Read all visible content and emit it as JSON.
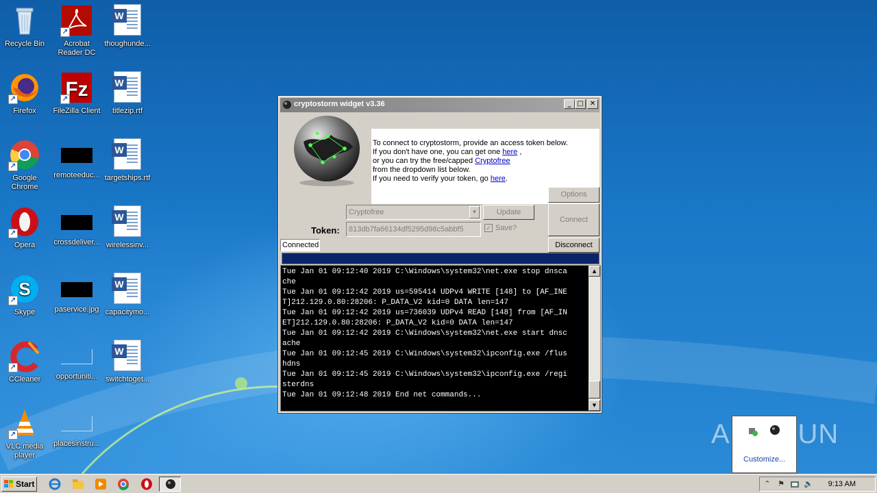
{
  "desktop": {
    "icons": [
      {
        "label": "Recycle Bin"
      },
      {
        "label": "Acrobat Reader DC"
      },
      {
        "label": "thoughunde..."
      },
      {
        "label": "Firefox"
      },
      {
        "label": "FileZilla Client"
      },
      {
        "label": "titlezip.rtf"
      },
      {
        "label": "Google Chrome"
      },
      {
        "label": "remoteeduc..."
      },
      {
        "label": "targetships.rtf"
      },
      {
        "label": "Opera"
      },
      {
        "label": "crossdeliver..."
      },
      {
        "label": "wirelessinv..."
      },
      {
        "label": "Skype"
      },
      {
        "label": "paservice.jpg"
      },
      {
        "label": "capacitymo..."
      },
      {
        "label": "CCleaner"
      },
      {
        "label": "opportuniti..."
      },
      {
        "label": "switchtoget..."
      },
      {
        "label": "VLC media player"
      },
      {
        "label": "placesinstru..."
      }
    ]
  },
  "window": {
    "title": "cryptostorm widget v3.36",
    "info": {
      "line1": "To connect to cryptostorm, provide an access token below.",
      "line2_pre": "If you don't have one, you can get one ",
      "line2_link": "here",
      "line2_post": " ,",
      "line3_pre": "or you can try the free/capped ",
      "line3_link": "Cryptofree",
      "line4": " from the dropdown list below.",
      "line5_pre": "If you need to verify your token, go ",
      "line5_link": "here",
      "line5_post": "."
    },
    "buttons": {
      "options": "Options",
      "update": "Update",
      "connect": "Connect",
      "disconnect": "Disconnect"
    },
    "server_select": "Cryptofree",
    "token_label": "Token:",
    "token_value": "813db7fa66134df5295d98c5abbf5",
    "save_label": "Save?",
    "save_checked_glyph": "✓",
    "status": "Connected",
    "log": [
      "Tue Jan 01 09:12:40 2019 C:\\Windows\\system32\\net.exe stop dnsca",
      "che",
      "Tue Jan 01 09:12:42 2019 us=595414 UDPv4 WRITE [148] to [AF_INE",
      "T]212.129.0.80:28206: P_DATA_V2 kid=0 DATA len=147",
      "Tue Jan 01 09:12:42 2019 us=736039 UDPv4 READ [148] from [AF_IN",
      "ET]212.129.0.80:28206: P_DATA_V2 kid=0 DATA len=147",
      "Tue Jan 01 09:12:42 2019 C:\\Windows\\system32\\net.exe start dnsc",
      "ache",
      "Tue Jan 01 09:12:45 2019 C:\\Windows\\system32\\ipconfig.exe /flus",
      "hdns",
      "Tue Jan 01 09:12:45 2019 C:\\Windows\\system32\\ipconfig.exe /regi",
      "sterdns",
      "Tue Jan 01 09:12:48 2019 End net commands..."
    ]
  },
  "tray_popup": {
    "label": "Customize..."
  },
  "watermark": "ANY RUN",
  "taskbar": {
    "start_label": "Start",
    "clock": "9:13 AM"
  }
}
